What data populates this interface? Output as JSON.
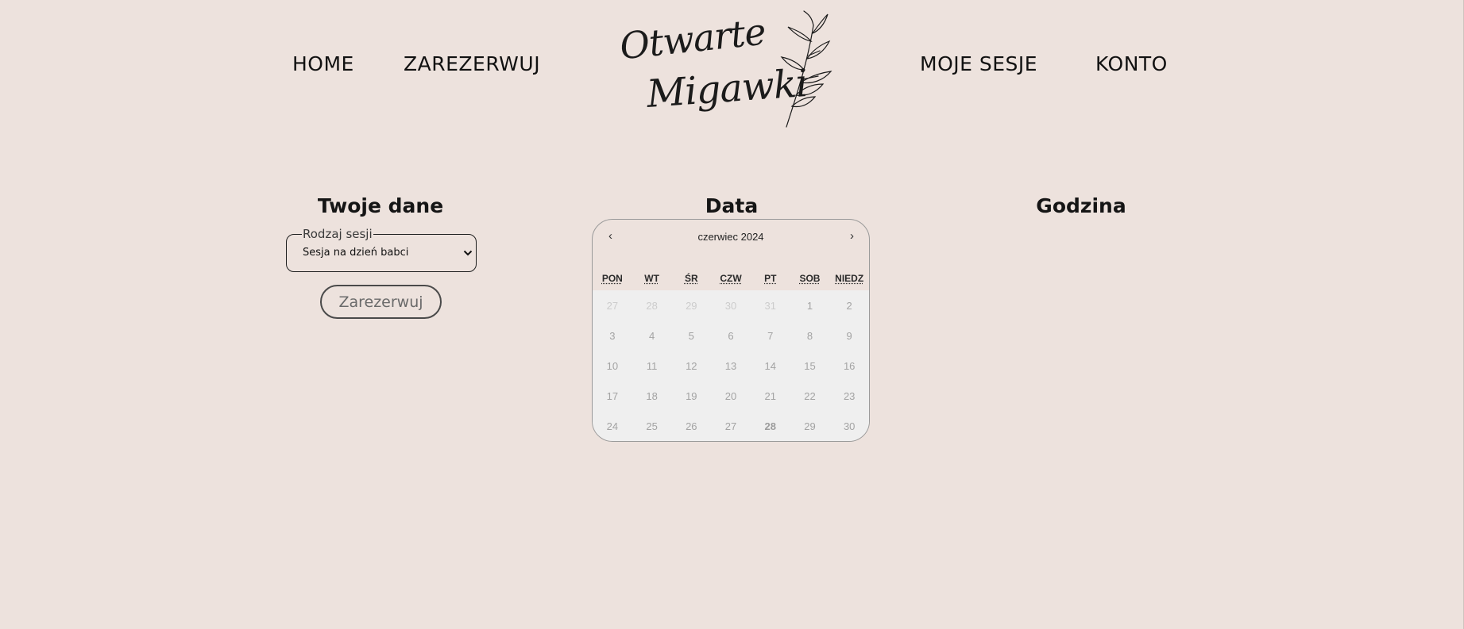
{
  "nav": {
    "home": "HOME",
    "book": "ZAREZERWUJ",
    "sessions": "MOJE SESJE",
    "account": "KONTO"
  },
  "logo": {
    "line1": "Otwarte",
    "line2": "Migawki",
    "icon": "branch-icon"
  },
  "sections": {
    "your_data": "Twoje dane",
    "date": "Data",
    "time": "Godzina"
  },
  "form": {
    "session_type_legend": "Rodzaj sesji",
    "session_type_value": "Sesja na dzień babci",
    "submit_label": "Zarezerwuj"
  },
  "calendar": {
    "prev": "‹",
    "next": "›",
    "month_label": "czerwiec 2024",
    "weekdays": [
      "PON",
      "WT",
      "ŚR",
      "CZW",
      "PT",
      "SOB",
      "NIEDZ"
    ],
    "weeks": [
      [
        "27",
        "28",
        "29",
        "30",
        "31",
        "1",
        "2"
      ],
      [
        "3",
        "4",
        "5",
        "6",
        "7",
        "8",
        "9"
      ],
      [
        "10",
        "11",
        "12",
        "13",
        "14",
        "15",
        "16"
      ],
      [
        "17",
        "18",
        "19",
        "20",
        "21",
        "22",
        "23"
      ],
      [
        "24",
        "25",
        "26",
        "27",
        "28",
        "29",
        "30"
      ]
    ],
    "today": "28"
  },
  "colors": {
    "background": "#ede2dd",
    "calendar_body": "#efefef",
    "text": "#1a1a1a",
    "disabled_day": "#a3a3a3",
    "adjacent_month_day": "#cccccc"
  }
}
